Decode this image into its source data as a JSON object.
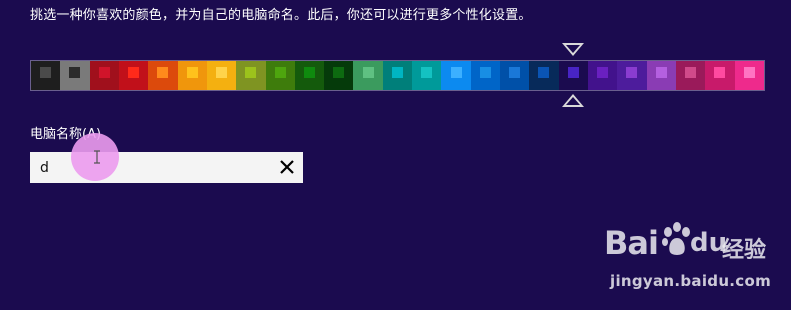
{
  "instruction": "挑选一种你喜欢的颜色，并为自己的电脑命名。此后，你还可以进行更多个性化设置。",
  "palette": {
    "selected_index": 19,
    "swatches": [
      {
        "bg": "#1e1e1e",
        "chip": "#4a4a4a"
      },
      {
        "bg": "#7a7a7a",
        "chip": "#2b2b2b"
      },
      {
        "bg": "#a0101c",
        "chip": "#d0142a"
      },
      {
        "bg": "#c1101a",
        "chip": "#ff2a1a"
      },
      {
        "bg": "#dc4a0c",
        "chip": "#ff8a1c"
      },
      {
        "bg": "#f0960c",
        "chip": "#ffc21c"
      },
      {
        "bg": "#f4b010",
        "chip": "#ffd34a"
      },
      {
        "bg": "#7f9422",
        "chip": "#9cc21c"
      },
      {
        "bg": "#3e7c0c",
        "chip": "#4ea50e"
      },
      {
        "bg": "#145a0c",
        "chip": "#0f8a0e"
      },
      {
        "bg": "#053a0a",
        "chip": "#0d6a10"
      },
      {
        "bg": "#3b9b5e",
        "chip": "#5fc182"
      },
      {
        "bg": "#007f7a",
        "chip": "#00b5c2"
      },
      {
        "bg": "#009a9a",
        "chip": "#14c2c2"
      },
      {
        "bg": "#0c8af0",
        "chip": "#3cb0ff"
      },
      {
        "bg": "#0065c8",
        "chip": "#188ee4"
      },
      {
        "bg": "#0050a8",
        "chip": "#1a78d8"
      },
      {
        "bg": "#072a5a",
        "chip": "#0a54b4"
      },
      {
        "bg": "#1b0b4f",
        "chip": "#4824c4"
      },
      {
        "bg": "#42128c",
        "chip": "#6a20c0"
      },
      {
        "bg": "#4d1c9c",
        "chip": "#8a3cd0"
      },
      {
        "bg": "#8a3cb4",
        "chip": "#b460e0"
      },
      {
        "bg": "#9a1a5a",
        "chip": "#d04a8a"
      },
      {
        "bg": "#c81a6a",
        "chip": "#ff4aa0"
      },
      {
        "bg": "#ee2a8c",
        "chip": "#ff74c2"
      }
    ]
  },
  "computer_name": {
    "label": "电脑名称(A)",
    "value": "d",
    "clear_symbol": "✕"
  },
  "watermark": {
    "bai": "Bai",
    "du": "du",
    "cn": "经验",
    "url": "jingyan.baidu.com"
  },
  "icons": {
    "clear": "close-icon",
    "selection_top": "triangle-down-icon",
    "selection_bottom": "triangle-up-icon",
    "text_cursor": "ibeam-cursor-icon",
    "watermark_paw": "paw-icon"
  },
  "colors": {
    "background": "#1b0b4f",
    "text": "#ffffff",
    "input_background": "#f4f4f4",
    "selection_marker": "#d9d9d9"
  }
}
